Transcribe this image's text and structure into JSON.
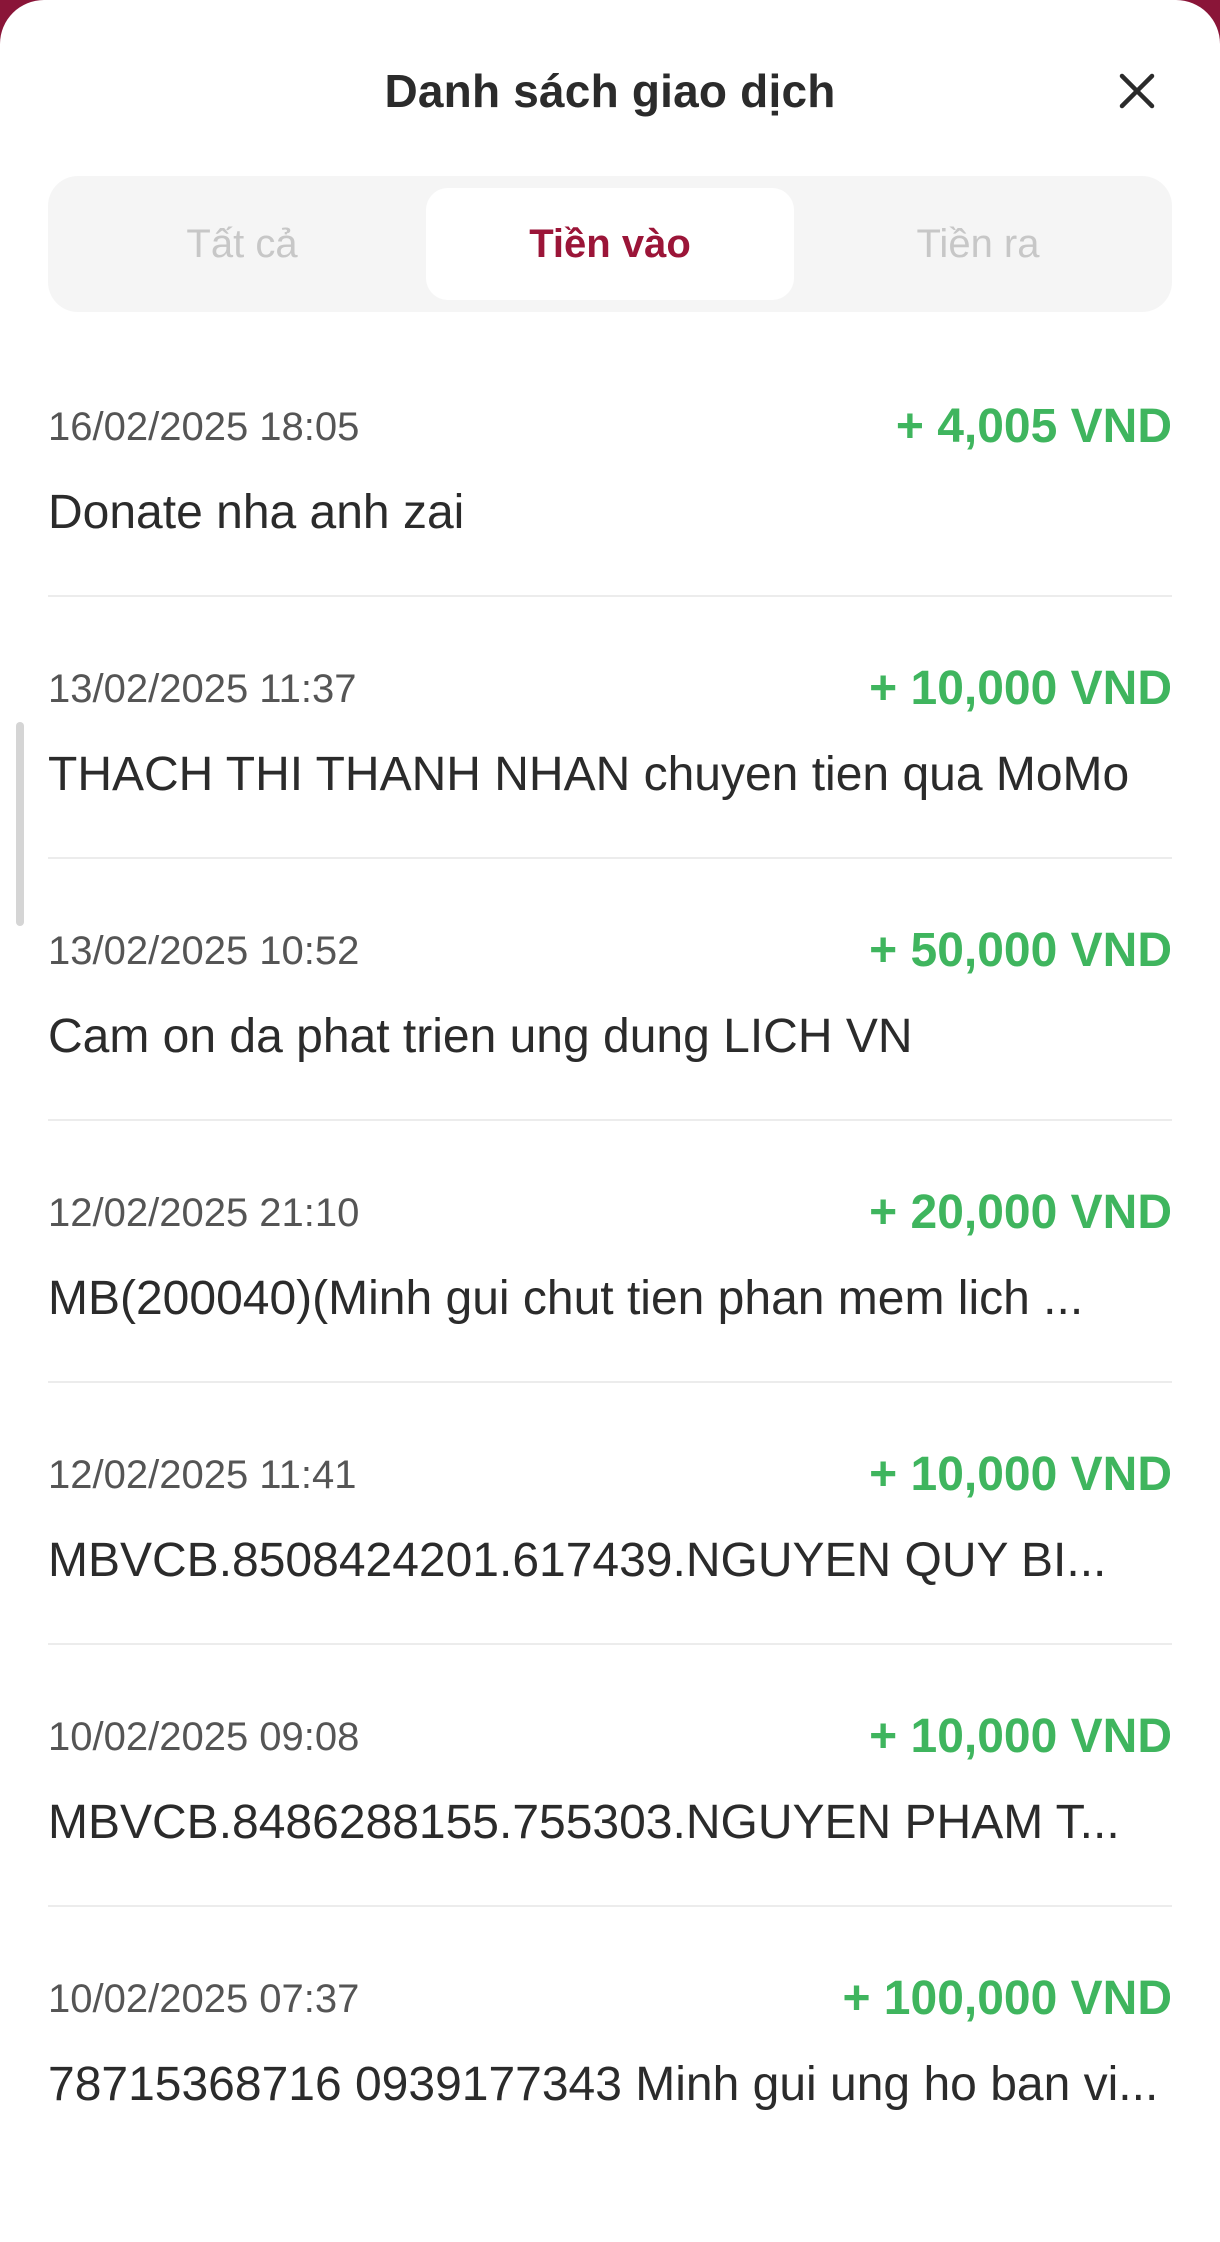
{
  "header": {
    "title": "Danh sách giao dịch"
  },
  "icons": {
    "close": "close-icon"
  },
  "tabs": [
    {
      "label": "Tất cả",
      "active": false
    },
    {
      "label": "Tiền vào",
      "active": true
    },
    {
      "label": "Tiền ra",
      "active": false
    }
  ],
  "colors": {
    "accent": "#9b1538",
    "amount_positive": "#3fb55e",
    "backdrop": "#8a1538"
  },
  "transactions": [
    {
      "time": "16/02/2025 18:05",
      "amount": "+ 4,005 VND",
      "description": "Donate nha anh zai"
    },
    {
      "time": "13/02/2025 11:37",
      "amount": "+ 10,000 VND",
      "description": "THACH THI THANH NHAN chuyen tien qua MoMo"
    },
    {
      "time": "13/02/2025 10:52",
      "amount": "+ 50,000 VND",
      "description": "Cam on da phat trien ung dung LICH VN"
    },
    {
      "time": "12/02/2025 21:10",
      "amount": "+ 20,000 VND",
      "description": "MB(200040)(Minh gui chut tien phan mem lich ..."
    },
    {
      "time": "12/02/2025 11:41",
      "amount": "+ 10,000 VND",
      "description": "MBVCB.8508424201.617439.NGUYEN QUY BI..."
    },
    {
      "time": "10/02/2025 09:08",
      "amount": "+ 10,000 VND",
      "description": "MBVCB.8486288155.755303.NGUYEN PHAM T..."
    },
    {
      "time": "10/02/2025 07:37",
      "amount": "+ 100,000 VND",
      "description": "78715368716 0939177343 Minh gui ung ho ban vi..."
    }
  ]
}
